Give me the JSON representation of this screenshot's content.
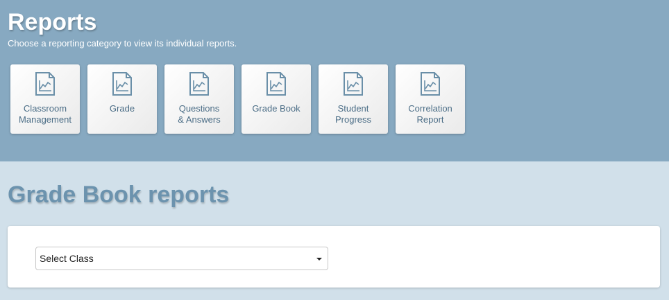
{
  "header": {
    "title": "Reports",
    "subtitle": "Choose a reporting category to view its individual reports.",
    "background_color": "#87a9c1"
  },
  "categories": [
    {
      "label": "Classroom\nManagement",
      "icon": "report-chart-icon"
    },
    {
      "label": "Grade",
      "icon": "report-chart-icon"
    },
    {
      "label": "Questions\n& Answers",
      "icon": "report-chart-icon"
    },
    {
      "label": "Grade Book",
      "icon": "report-chart-icon"
    },
    {
      "label": "Student\nProgress",
      "icon": "report-chart-icon"
    },
    {
      "label": "Correlation\nReport",
      "icon": "report-chart-icon"
    }
  ],
  "section": {
    "title": "Grade Book reports",
    "class_select": {
      "selected": "Select Class"
    }
  },
  "colors": {
    "page_background": "#d1e0ea",
    "card_text": "#4b6d86",
    "section_title": "#6c93ae"
  }
}
